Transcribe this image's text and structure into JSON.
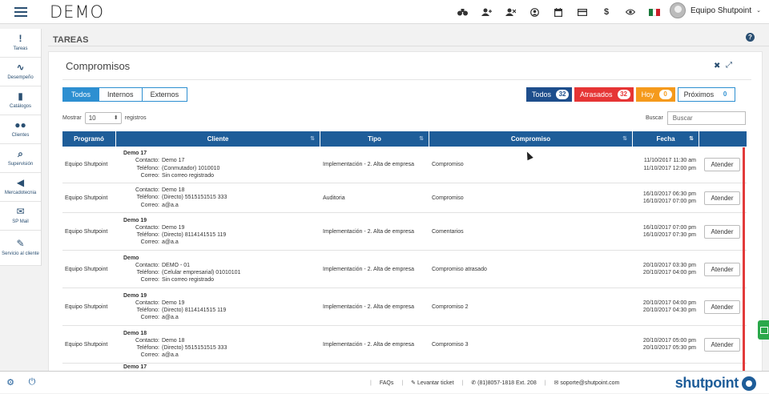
{
  "topbar": {
    "logo": "DEMO",
    "user_name": "Equipo Shutpoint",
    "icons": [
      "binoculars-icon",
      "add-user-icon",
      "remove-user-icon",
      "user-circle-icon",
      "calendar-icon",
      "card-icon",
      "dollar-icon",
      "eye-icon",
      "mexico-flag-icon"
    ],
    "flag_colors": [
      "#1a7a3c",
      "#ffffff",
      "#cc1f2a"
    ]
  },
  "sidebar": {
    "items": [
      {
        "label": "Tareas",
        "icon": "!"
      },
      {
        "label": "Desempeño",
        "icon": "∿"
      },
      {
        "label": "Catálogos",
        "icon": "▮"
      },
      {
        "label": "Clientes",
        "icon": "●●"
      },
      {
        "label": "Supervisión",
        "icon": "⌕"
      },
      {
        "label": "Mercadotecnia",
        "icon": "◀"
      },
      {
        "label": "SP Mail",
        "icon": "✉"
      },
      {
        "label": "Servicio al cliente",
        "icon": "✎"
      }
    ]
  },
  "page": {
    "section": "TAREAS"
  },
  "panel": {
    "title": "Compromisos",
    "tabs": [
      "Todos",
      "Internos",
      "Externos"
    ],
    "counters": [
      {
        "label": "Todos",
        "count": "32"
      },
      {
        "label": "Atrasados",
        "count": "32"
      },
      {
        "label": "Hoy",
        "count": "0"
      },
      {
        "label": "Próximos",
        "count": "0"
      }
    ],
    "show_label": "Mostrar",
    "page_size": "10",
    "records_label": "registros",
    "search_label": "Buscar",
    "search_placeholder": "Buscar"
  },
  "table": {
    "columns": [
      "Programó",
      "Cliente",
      "Tipo",
      "Compromiso",
      "Fecha",
      ""
    ],
    "rows": [
      {
        "programo": "Equipo Shutpoint",
        "cliente": "Demo 17",
        "contacto": "Demo 17",
        "telefono": "(Conmutador) 1010010",
        "correo": "Sin correo registrado",
        "tipo": "Implementación - 2. Alta de empresa",
        "compromiso": "Compromiso",
        "fecha1": "11/10/2017 11:30 am",
        "fecha2": "11/10/2017 12:00 pm",
        "accion": "Atender"
      },
      {
        "programo": "Equipo Shutpoint",
        "cliente": "",
        "contacto": "Demo 18",
        "telefono": "(Directo) 5515151515 333",
        "correo": "a@a.a",
        "tipo": "Auditoria",
        "compromiso": "Compromiso",
        "fecha1": "16/10/2017 06:30 pm",
        "fecha2": "16/10/2017 07:00 pm",
        "accion": "Atender"
      },
      {
        "programo": "Equipo Shutpoint",
        "cliente": "Demo 19",
        "contacto": "Demo 19",
        "telefono": "(Directo) 8114141515 119",
        "correo": "a@a.a",
        "tipo": "Implementación - 2. Alta de empresa",
        "compromiso": "Comentarios",
        "fecha1": "16/10/2017 07:00 pm",
        "fecha2": "16/10/2017 07:30 pm",
        "accion": "Atender"
      },
      {
        "programo": "Equipo Shutpoint",
        "cliente": "Demo",
        "contacto": "DEMO - 01",
        "telefono": "(Celular empresarial) 01010101",
        "correo": "Sin correo registrado",
        "tipo": "Implementación - 2. Alta de empresa",
        "compromiso": "Compromiso atrasado",
        "fecha1": "20/10/2017 03:30 pm",
        "fecha2": "20/10/2017 04:00 pm",
        "accion": "Atender"
      },
      {
        "programo": "Equipo Shutpoint",
        "cliente": "Demo 19",
        "contacto": "Demo 19",
        "telefono": "(Directo) 8114141515 119",
        "correo": "a@a.a",
        "tipo": "Implementación - 2. Alta de empresa",
        "compromiso": "Compromiso 2",
        "fecha1": "20/10/2017 04:00 pm",
        "fecha2": "20/10/2017 04:30 pm",
        "accion": "Atender"
      },
      {
        "programo": "Equipo Shutpoint",
        "cliente": "Demo 18",
        "contacto": "Demo 18",
        "telefono": "(Directo) 5515151515 333",
        "correo": "a@a.a",
        "tipo": "Implementación - 2. Alta de empresa",
        "compromiso": "Compromiso 3",
        "fecha1": "20/10/2017 05:00 pm",
        "fecha2": "20/10/2017 05:30 pm",
        "accion": "Atender"
      },
      {
        "programo": "",
        "cliente": "Demo 17",
        "contacto": "",
        "telefono": "",
        "correo": "",
        "tipo": "",
        "compromiso": "",
        "fecha1": "",
        "fecha2": "",
        "accion": ""
      }
    ],
    "labels": {
      "contacto": "Contacto:",
      "telefono": "Teléfono:",
      "correo": "Correo:"
    }
  },
  "footer": {
    "faqs": "FAQs",
    "ticket": "Levantar ticket",
    "phone": "(81)8057-1818 Ext. 208",
    "email": "soporte@shutpoint.com",
    "brand": "shutpoint"
  },
  "colors": {
    "primary": "#1e5d99",
    "tab_active": "#2d8fd1",
    "atrasados": "#e63535",
    "hoy": "#f59a1c",
    "todos": "#1e4e8c"
  }
}
